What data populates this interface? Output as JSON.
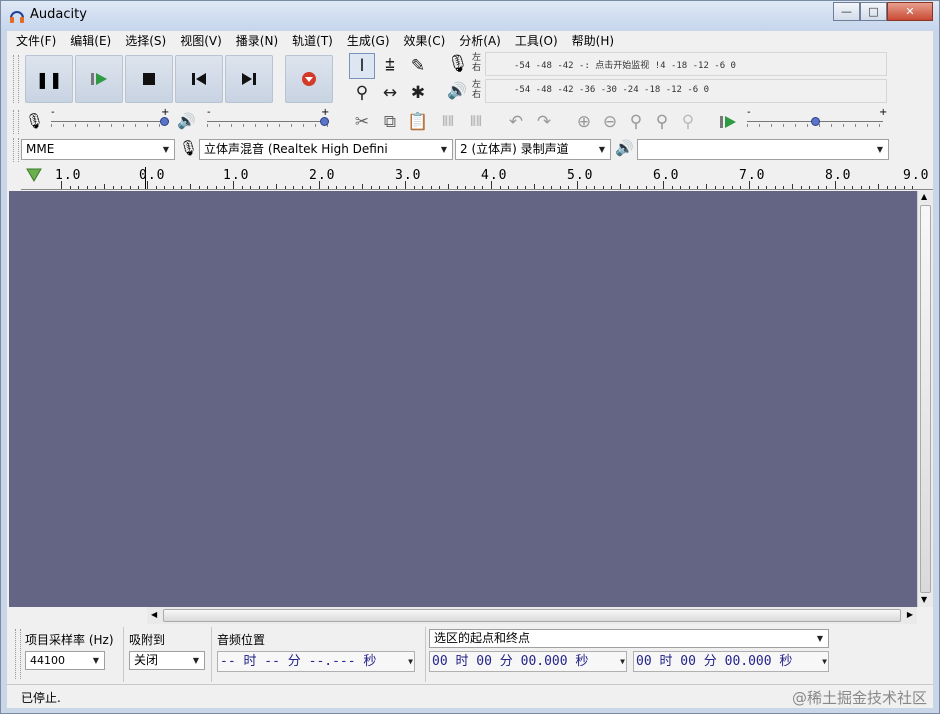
{
  "window": {
    "title": "Audacity",
    "minimize": "—",
    "maximize": "□",
    "close": "✕"
  },
  "menu": [
    "文件(F)",
    "编辑(E)",
    "选择(S)",
    "视图(V)",
    "播录(N)",
    "轨道(T)",
    "生成(G)",
    "效果(C)",
    "分析(A)",
    "工具(O)",
    "帮助(H)"
  ],
  "meters": {
    "left": "左",
    "right": "右",
    "record_scale": "-54   -48   -42   -:  点击开始监视  !4   -18   -12   -6    0",
    "play_scale": "-54   -48   -42   -36   -30   -24   -18   -12   -6    0"
  },
  "sliders": {
    "record_volume": 1.0,
    "play_volume": 1.0,
    "play_speed": 0.5,
    "minus": "-",
    "plus": "+"
  },
  "device": {
    "host": "MME",
    "input": "立体声混音 (Realtek High Defini",
    "channels": "2 (立体声) 录制声道",
    "output": ""
  },
  "ruler": [
    "1.0",
    "0.0",
    "1.0",
    "2.0",
    "3.0",
    "4.0",
    "5.0",
    "6.0",
    "7.0",
    "8.0",
    "9.0"
  ],
  "selection": {
    "rate_label": "项目采样率 (Hz)",
    "rate_value": "44100",
    "snap_label": "吸附到",
    "snap_value": "关闭",
    "pos_label": "音频位置",
    "pos_value": "-- 时 -- 分 --.--- 秒",
    "range_label": "选区的起点和终点",
    "start_value": "00 时 00 分 00.000 秒",
    "end_value": "00 时 00 分 00.000 秒"
  },
  "status": {
    "text": "已停止.",
    "watermark": "@稀土掘金技术社区"
  },
  "colors": {
    "track_bg": "#646485",
    "button_bg": "#c8d3e2",
    "record_red": "#d23b2a",
    "play_green": "#2e9a43"
  }
}
